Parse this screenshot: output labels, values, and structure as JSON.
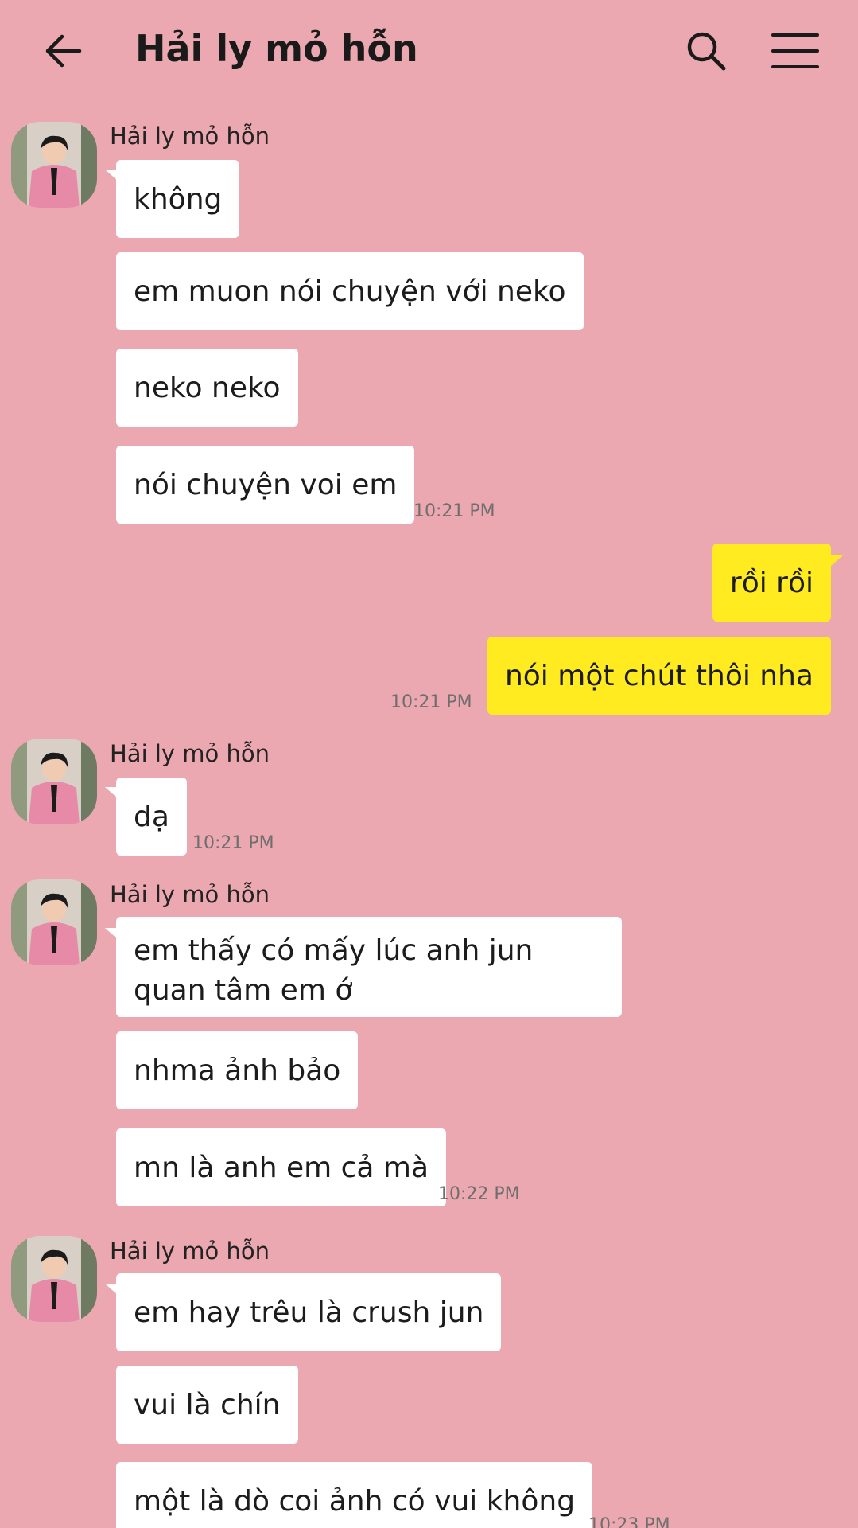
{
  "header": {
    "title": "Hải ly mỏ hỗn",
    "back_icon": "arrow-left-icon",
    "search_icon": "search-icon",
    "menu_icon": "hamburger-menu-icon"
  },
  "colors": {
    "background": "#eca8b0",
    "incoming_bubble": "#ffffff",
    "outgoing_bubble": "#ffeb1f"
  },
  "messages": {
    "g1": {
      "sender": "Hải ly mỏ hỗn",
      "m1": "không",
      "m2": "em muon nói chuyện với neko",
      "m3": "neko neko",
      "m4": "nói chuyện voi em",
      "time": "10:21 PM"
    },
    "g2": {
      "m1": "rồi rồi",
      "m2": "nói một chút thôi nha",
      "time": "10:21 PM"
    },
    "g3": {
      "sender": "Hải ly mỏ hỗn",
      "m1": "dạ",
      "time": "10:21 PM"
    },
    "g4": {
      "sender": "Hải ly mỏ hỗn",
      "m1": "em thấy có mấy lúc anh jun quan tâm em ớ",
      "m2": "nhma ảnh bảo",
      "m3": "mn là anh em cả mà",
      "time": "10:22 PM"
    },
    "g5": {
      "sender": "Hải ly mỏ hỗn",
      "m1": "em hay trêu là crush jun",
      "m2": "vui là chín",
      "m3": "một là dò coi ảnh có vui không",
      "time": "10:23 PM"
    }
  }
}
